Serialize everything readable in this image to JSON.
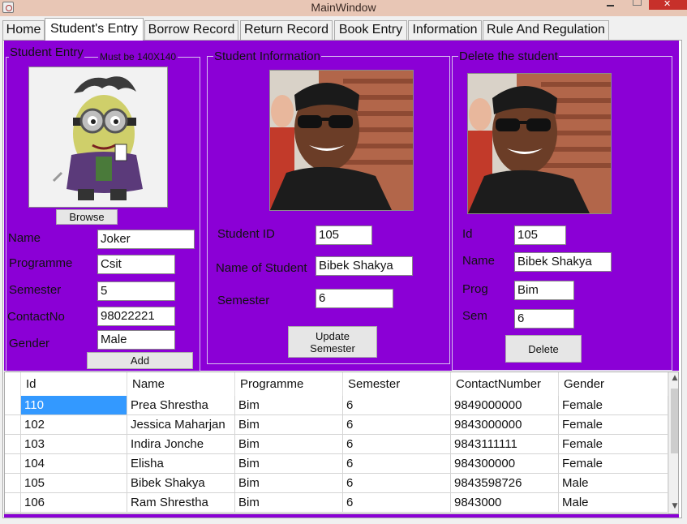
{
  "window": {
    "title": "MainWindow"
  },
  "tabs": [
    {
      "label": "Home"
    },
    {
      "label": "Student's Entry"
    },
    {
      "label": "Borrow Record"
    },
    {
      "label": "Return Record"
    },
    {
      "label": "Book Entry"
    },
    {
      "label": "Information"
    },
    {
      "label": "Rule And Regulation"
    }
  ],
  "active_tab": "Student's Entry",
  "student_entry": {
    "legend": "Student Entry",
    "hint": "Must be 140X140",
    "browse_label": "Browse",
    "fields": [
      {
        "label": "Name",
        "value": "Joker"
      },
      {
        "label": "Programme",
        "value": "Csit"
      },
      {
        "label": "Semester",
        "value": "5"
      },
      {
        "label": "ContactNo",
        "value": "98022221"
      },
      {
        "label": "Gender",
        "value": "Male"
      }
    ],
    "add_label": "Add"
  },
  "student_information": {
    "legend": "Student Information",
    "fields": [
      {
        "label": "Student ID",
        "value": "105"
      },
      {
        "label": "Name of Student",
        "value": "Bibek Shakya"
      },
      {
        "label": "Semester",
        "value": "6"
      }
    ],
    "update_label_line1": "Update",
    "update_label_line2": "Semester"
  },
  "delete_student": {
    "legend": "Delete the student",
    "fields": [
      {
        "label": "Id",
        "value": "105"
      },
      {
        "label": "Name",
        "value": "Bibek Shakya"
      },
      {
        "label": "Prog",
        "value": "Bim"
      },
      {
        "label": "Sem",
        "value": "6"
      }
    ],
    "delete_label": "Delete"
  },
  "table": {
    "columns": [
      "Id",
      "Name",
      "Programme",
      "Semester",
      "ContactNumber",
      "Gender"
    ],
    "rows": [
      [
        "110",
        "Prea Shrestha",
        "Bim",
        "6",
        "9849000000",
        "Female"
      ],
      [
        "102",
        "Jessica Maharjan",
        "Bim",
        "6",
        "9843000000",
        "Female"
      ],
      [
        "103",
        "Indira Jonche",
        "Bim",
        "6",
        "9843111111",
        "Female"
      ],
      [
        "104",
        "Elisha",
        "Bim",
        "6",
        "984300000",
        "Female"
      ],
      [
        "105",
        "Bibek Shakya",
        "Bim",
        "6",
        "9843598726",
        "Male"
      ],
      [
        "106",
        "Ram Shrestha",
        "Bim",
        "6",
        "9843000",
        "Male"
      ]
    ],
    "selected_row": 0
  },
  "colors": {
    "panel_purple": "#8b00d6",
    "selection_blue": "#3399ff",
    "close_red": "#c7302a"
  }
}
